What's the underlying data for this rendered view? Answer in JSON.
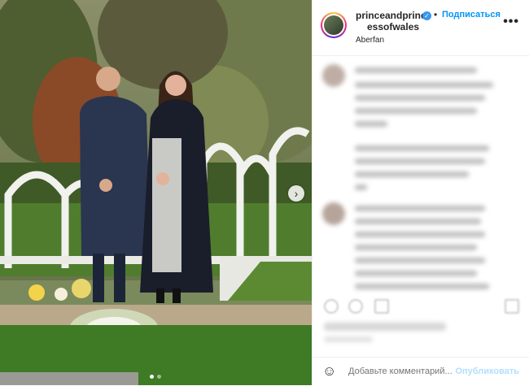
{
  "post": {
    "username_line1": "princeandprinc",
    "username_line2": "essofwales",
    "separator": "•",
    "follow_label": "Подписаться",
    "location": "Aberfan",
    "more_label": "•••"
  },
  "carousel": {
    "next_label": "›",
    "slide_count": 2,
    "active_slide": 1
  },
  "comment_box": {
    "emoji_label": "☺",
    "placeholder": "Добавьте комментарий...",
    "publish_label": "Опубликовать"
  },
  "colors": {
    "accent": "#0095f6",
    "publish_disabled": "#b2dffc",
    "text": "#262626"
  }
}
